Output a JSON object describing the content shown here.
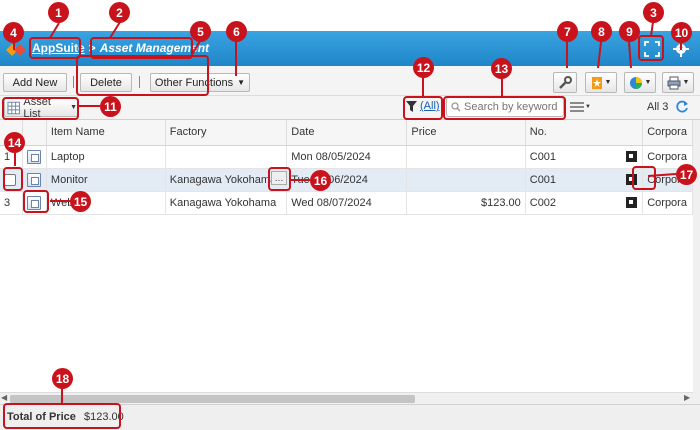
{
  "header": {
    "app_name": "AppSuite",
    "separator": ">",
    "page_title": "Asset Management"
  },
  "toolbar": {
    "add_new": "Add New",
    "delete": "Delete",
    "other_functions": "Other Functions"
  },
  "subbar": {
    "list_name": "Asset List",
    "filter_label": "(All)",
    "search_placeholder": "Search by keyword",
    "count": "All 3"
  },
  "table": {
    "columns": [
      "Item Name",
      "Factory",
      "Date",
      "Price",
      "No.",
      "Corpora"
    ],
    "rows": [
      {
        "index": "1",
        "item": "Laptop",
        "factory": "",
        "date": "Mon 08/05/2024",
        "price": "",
        "no": "C001",
        "corp": "Corpora"
      },
      {
        "index": "",
        "item": "Monitor",
        "factory": "Kanagawa Yokohama",
        "date": "Tue 08/06/2024",
        "price": "",
        "no": "C001",
        "corp": "Corpora"
      },
      {
        "index": "3",
        "item": "Web",
        "factory": "Kanagawa Yokohama",
        "date": "Wed 08/07/2024",
        "price": "$123.00",
        "no": "C002",
        "corp": "Corpora"
      }
    ]
  },
  "footer": {
    "total_label": "Total of Price",
    "total_value": "$123.00"
  },
  "callouts": [
    "1",
    "2",
    "3",
    "4",
    "5",
    "6",
    "7",
    "8",
    "9",
    "10",
    "11",
    "12",
    "13",
    "14",
    "15",
    "16",
    "17",
    "18"
  ],
  "colors": {
    "header_blue": "#1f86c9",
    "callout_red": "#c8121c"
  }
}
